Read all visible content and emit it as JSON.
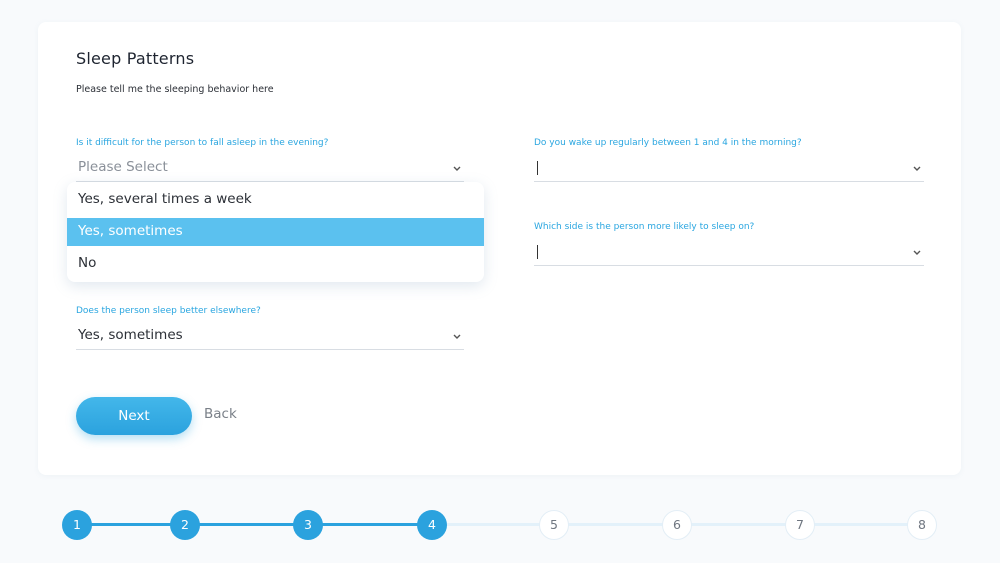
{
  "form": {
    "title": "Sleep Patterns",
    "subtitle": "Please tell me the sleeping behavior here",
    "questions": [
      {
        "label": "Is it difficult for the person to fall asleep in the evening?",
        "value": "Please Select"
      },
      {
        "label": "Do you wake up regularly between 1 and 4 in the morning?",
        "value": ""
      },
      {
        "label": "Which side is the person more likely to sleep on?",
        "value": ""
      },
      {
        "label": "Does the person sleep better elsewhere?",
        "value": "Yes, sometimes"
      }
    ],
    "dropdown_options": [
      "Yes, several times a week",
      "Yes, sometimes",
      "No"
    ],
    "highlighted_option": "Yes, sometimes"
  },
  "actions": {
    "next_label": "Next",
    "back_label": "Back"
  },
  "stepper": {
    "steps": [
      "1",
      "2",
      "3",
      "4",
      "5",
      "6",
      "7",
      "8"
    ],
    "current_step": 4
  },
  "colors": {
    "accent": "#2ba2de",
    "highlight": "#5bc1ef",
    "label": "#2aa6e0"
  }
}
